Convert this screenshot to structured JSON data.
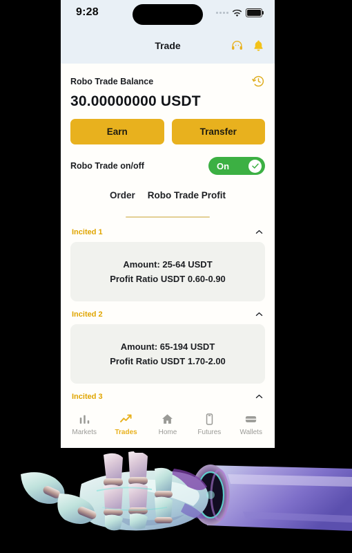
{
  "status_bar": {
    "time": "9:28",
    "signal_icon": "signal-dots-icon",
    "wifi_icon": "wifi-icon",
    "battery_icon": "battery-full-icon"
  },
  "header": {
    "title": "Trade",
    "support_icon": "headset-support-icon",
    "notification_icon": "bell-icon"
  },
  "balance": {
    "label": "Robo Trade Balance",
    "amount": "30.00000000 USDT",
    "history_icon": "history-clock-icon"
  },
  "actions": {
    "earn_label": "Earn",
    "transfer_label": "Transfer"
  },
  "robo_toggle": {
    "label": "Robo Trade on/off",
    "state_text": "On",
    "enabled": true,
    "check_icon": "check-circle-icon"
  },
  "tabs": {
    "items": [
      {
        "label": "Order",
        "active": false
      },
      {
        "label": "Robo Trade Profit",
        "active": true
      }
    ]
  },
  "incited_cards": [
    {
      "title": "Incited 1",
      "amount_line": "Amount: 25-64 USDT",
      "ratio_line": "Profit Ratio USDT 0.60-0.90",
      "chevron_icon": "chevron-up-icon"
    },
    {
      "title": "Incited 2",
      "amount_line": "Amount: 65-194 USDT",
      "ratio_line": "Profit Ratio USDT 1.70-2.00",
      "chevron_icon": "chevron-up-icon"
    },
    {
      "title": "Incited 3",
      "amount_line": "",
      "ratio_line": "",
      "chevron_icon": "chevron-up-icon"
    }
  ],
  "bottom_nav": {
    "items": [
      {
        "label": "Markets",
        "icon": "bar-chart-icon",
        "active": false
      },
      {
        "label": "Trades",
        "icon": "trending-up-arrow-icon",
        "active": true
      },
      {
        "label": "Home",
        "icon": "home-icon",
        "active": false
      },
      {
        "label": "Futures",
        "icon": "mobile-phone-icon",
        "active": false
      },
      {
        "label": "Wallets",
        "icon": "wallet-icon",
        "active": false
      }
    ]
  },
  "artwork": {
    "description": "robotic-hand-3d-render"
  },
  "colors": {
    "accent_gold": "#E8B11E",
    "toggle_green": "#3CB043",
    "header_bg": "#E9F0F6",
    "card_bg": "#F1F2EE",
    "incited_title": "#E0A500"
  }
}
